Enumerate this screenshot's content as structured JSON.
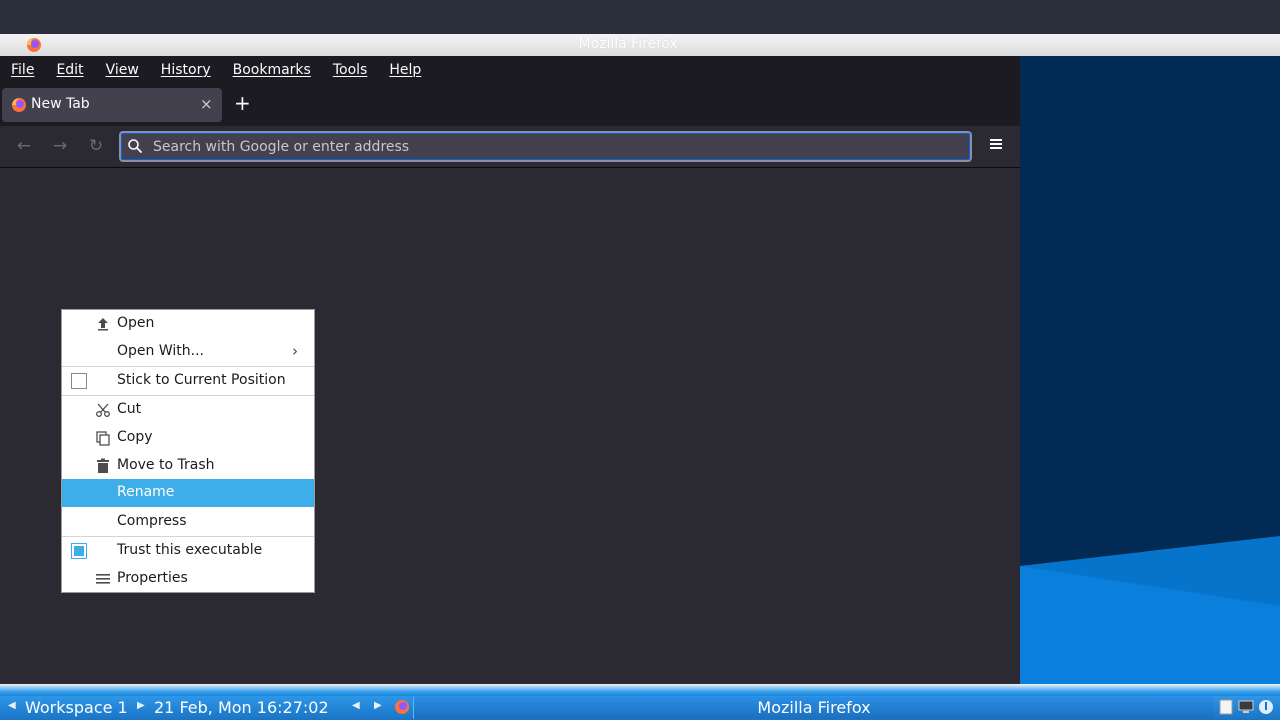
{
  "window": {
    "title": "Mozilla Firefox"
  },
  "menubar": {
    "items": [
      "File",
      "Edit",
      "View",
      "History",
      "Bookmarks",
      "Tools",
      "Help"
    ]
  },
  "tabs": [
    {
      "label": "New Tab",
      "icon": "firefox-icon",
      "close": "×"
    }
  ],
  "newtab": {
    "label": "+"
  },
  "navbar": {
    "back": "←",
    "forward": "→",
    "reload": "↻",
    "url_value": "",
    "url_placeholder": "Search with Google or enter address",
    "menu_icon": "hamburger-icon"
  },
  "context_menu": {
    "items": [
      {
        "label": "Open",
        "icon": "upload-icon"
      },
      {
        "label": "Open With...",
        "submenu_arrow": "›"
      },
      {
        "label": "Stick to Current Position",
        "checkbox": false
      },
      {
        "label": "Cut",
        "icon": "scissors-icon"
      },
      {
        "label": "Copy",
        "icon": "copy-icon"
      },
      {
        "label": "Move to Trash",
        "icon": "trash-icon"
      },
      {
        "label": "Rename",
        "selected": true
      },
      {
        "label": "Compress"
      },
      {
        "label": "Trust this executable",
        "checkbox": true
      },
      {
        "label": "Properties",
        "icon": "list-icon"
      }
    ]
  },
  "taskbar": {
    "workspace": "Workspace 1",
    "clock": "21 Feb, Mon 16:27:02",
    "task_label": "Mozilla Firefox",
    "left_arrow": "◀",
    "right_arrow": "▶",
    "prev_arrow": "◀",
    "next_arrow": "▶"
  },
  "colors": {
    "accent": "#3daee9",
    "firefox_bg": "#2b2a33",
    "toolbar_bg": "#1c1b22",
    "taskbar_blue": "#1a74c4"
  }
}
